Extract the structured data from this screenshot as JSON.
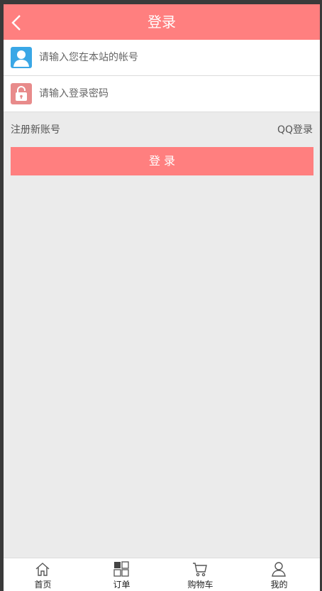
{
  "header": {
    "title": "登录"
  },
  "form": {
    "username_placeholder": "请输入您在本站的帐号",
    "password_placeholder": "请输入登录密码",
    "register_link": "注册新账号",
    "qq_login_link": "QQ登录",
    "login_button": "登 录"
  },
  "tabbar": {
    "items": [
      {
        "label": "首页",
        "icon": "home-icon"
      },
      {
        "label": "订单",
        "icon": "grid-icon"
      },
      {
        "label": "购物车",
        "icon": "cart-icon"
      },
      {
        "label": "我的",
        "icon": "user-icon"
      }
    ]
  },
  "colors": {
    "accent": "#ff7f7f",
    "background": "#ebebeb",
    "user_icon_bg": "#3aa7e6",
    "lock_icon_bg": "#e88b8b"
  }
}
